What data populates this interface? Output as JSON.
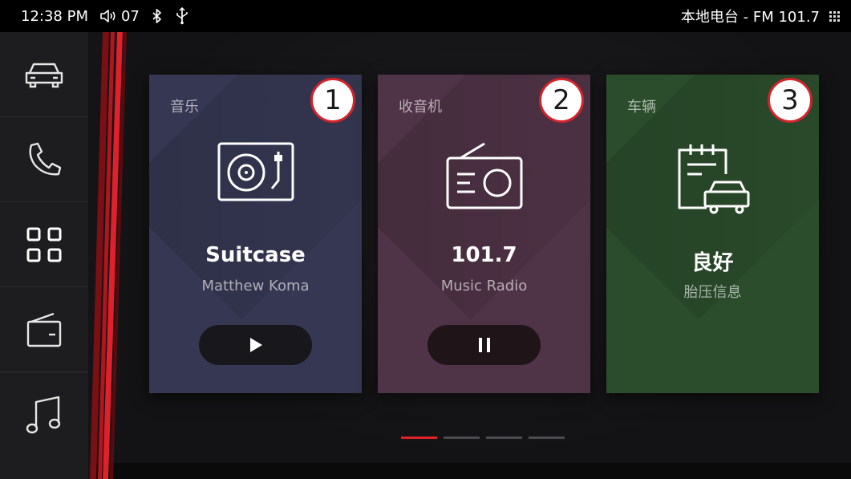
{
  "status_bar": {
    "time": "12:38 PM",
    "volume": "07",
    "now_playing": "本地电台 - FM  101.7"
  },
  "sidebar": {
    "items": [
      {
        "icon": "car-icon"
      },
      {
        "icon": "phone-icon"
      },
      {
        "icon": "apps-grid-icon"
      },
      {
        "icon": "radio-icon"
      },
      {
        "icon": "music-note-icon"
      }
    ]
  },
  "cards": [
    {
      "label": "音乐",
      "badge": "1",
      "title": "Suitcase",
      "subtitle": "Matthew Koma",
      "icon": "turntable-icon",
      "control": "play-icon",
      "color": "#363853"
    },
    {
      "label": "收音机",
      "badge": "2",
      "title": "101.7",
      "subtitle": "Music Radio",
      "icon": "radio-icon",
      "control": "pause-icon",
      "color": "#4f3346"
    },
    {
      "label": "车辆",
      "badge": "3",
      "title": "良好",
      "subtitle": "胎压信息",
      "icon": "vehicle-report-icon",
      "color": "#2b4d2c"
    }
  ],
  "pager": {
    "count": 4,
    "active_index": 0,
    "active_color": "#e0202a"
  },
  "accent_color": "#e0202a"
}
